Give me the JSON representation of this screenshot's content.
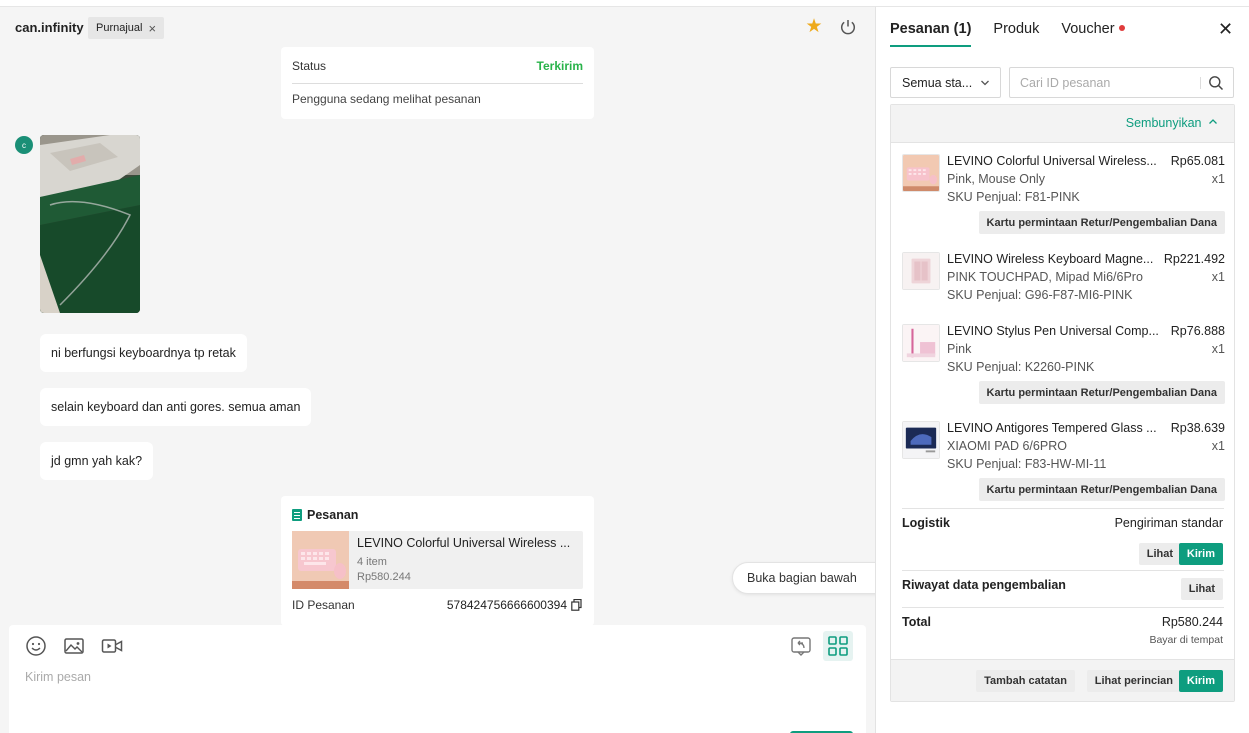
{
  "header": {
    "username": "can.infinity",
    "tag_label": "Purnajual"
  },
  "status_card": {
    "label": "Status",
    "value": "Terkirim",
    "message": "Pengguna sedang melihat pesanan"
  },
  "avatar_initial": "c",
  "messages": [
    "ni berfungsi keyboardnya tp retak",
    "selain keyboard dan anti gores. semua aman",
    "jd gmn yah kak?"
  ],
  "order_card": {
    "title": "Pesanan",
    "product_name": "LEVINO Colorful Universal Wireless ...",
    "item_count": "4 item",
    "price": "Rp580.244",
    "id_label": "ID Pesanan",
    "id_value": "578424756666600394"
  },
  "jump_button": "Buka bagian bawah",
  "composer": {
    "placeholder": "Kirim pesan"
  },
  "panel": {
    "tabs": [
      "Pesanan (1)",
      "Produk",
      "Voucher"
    ],
    "filter_label": "Semua sta...",
    "search_placeholder": "Cari ID pesanan",
    "hide_label": "Sembunyikan",
    "items": [
      {
        "title": "LEVINO Colorful Universal Wireless...",
        "price": "Rp65.081",
        "variant": "Pink, Mouse Only",
        "qty": "x1",
        "sku": "SKU Penjual: F81-PINK",
        "button": "Kartu permintaan Retur/Pengembalian Dana"
      },
      {
        "title": "LEVINO Wireless Keyboard Magne...",
        "price": "Rp221.492",
        "variant": "PINK TOUCHPAD, Mipad Mi6/6Pro",
        "qty": "x1",
        "sku": "SKU Penjual: G96-F87-MI6-PINK",
        "button": ""
      },
      {
        "title": "LEVINO Stylus Pen Universal Comp...",
        "price": "Rp76.888",
        "variant": "Pink",
        "qty": "x1",
        "sku": "SKU Penjual: K2260-PINK",
        "button": "Kartu permintaan Retur/Pengembalian Dana"
      },
      {
        "title": "LEVINO Antigores Tempered Glass ...",
        "price": "Rp38.639",
        "variant": "XIAOMI PAD 6/6PRO",
        "qty": "x1",
        "sku": "SKU Penjual: F83-HW-MI-11",
        "button": "Kartu permintaan Retur/Pengembalian Dana"
      }
    ],
    "logistics_label": "Logistik",
    "logistics_value": "Pengiriman standar",
    "view_label": "Lihat",
    "send_label": "Kirim",
    "return_history_label": "Riwayat data pengembalian",
    "total_label": "Total",
    "total_value": "Rp580.244",
    "payment_note": "Bayar di tempat",
    "add_note_label": "Tambah catatan",
    "view_details_label": "Lihat perincian"
  },
  "colors": {
    "accent": "#0e9d7f",
    "status_green": "#29b34a",
    "star": "#eeaa1c",
    "notif_dot": "#e03c3c"
  },
  "icons": [
    "star-icon",
    "power-icon",
    "close-icon",
    "emoji-icon",
    "image-icon",
    "video-icon",
    "quick-reply-icon",
    "grid-icon",
    "search-icon",
    "chevron-down-icon",
    "chevron-up-icon",
    "copy-icon",
    "document-icon"
  ]
}
